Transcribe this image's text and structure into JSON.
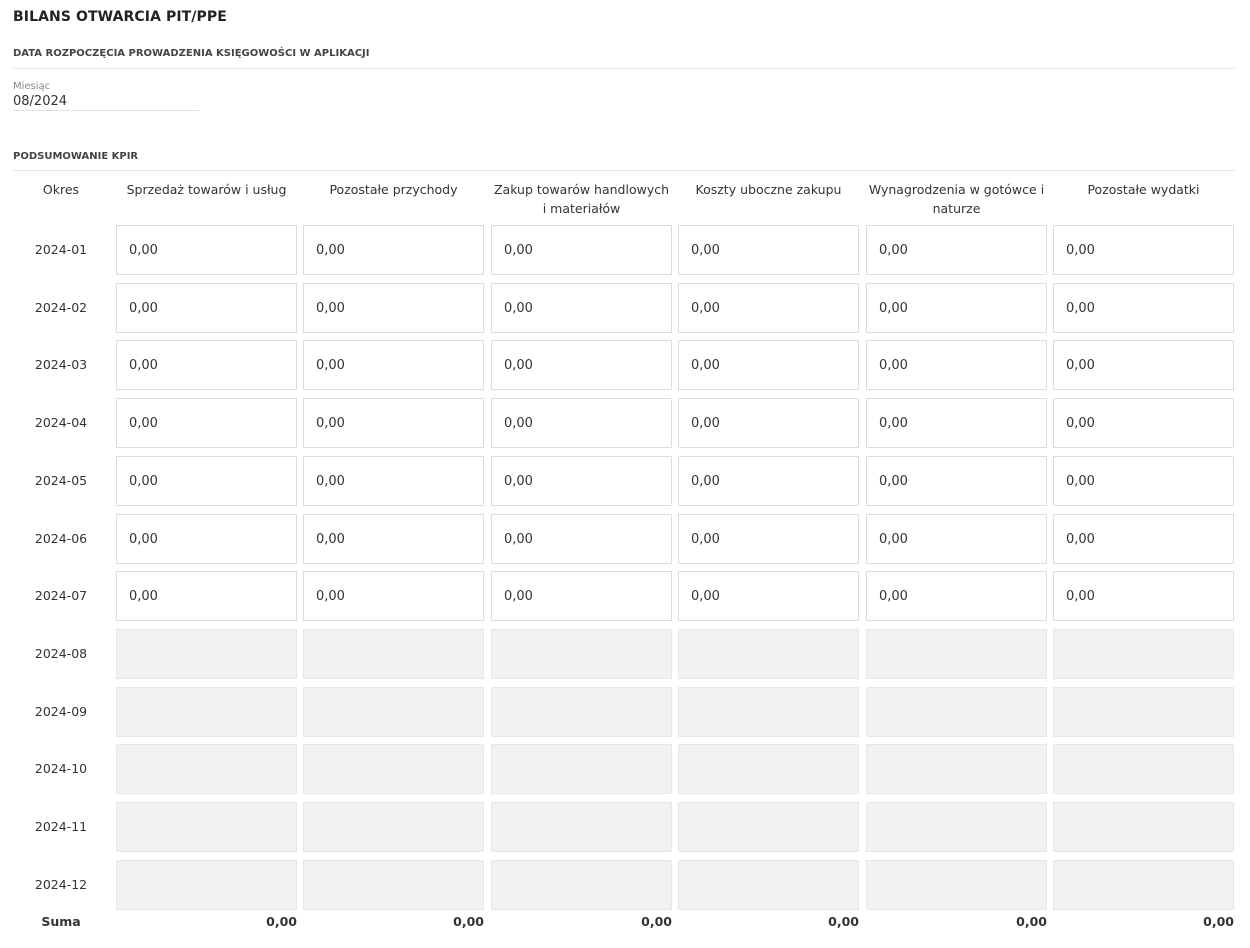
{
  "page_title": "BILANS OTWARCIA PIT/PPE",
  "start_section": {
    "title": "DATA ROZPOCZĘCIA PROWADZENIA KSIĘGOWOŚCI W APLIKACJI",
    "month_label": "Miesiąc",
    "month_value": "08/2024"
  },
  "kpir": {
    "title": "PODSUMOWANIE KPIR",
    "period_header": "Okres",
    "columns": [
      "Sprzedaż towarów i usług",
      "Pozostałe przychody",
      "Zakup towarów handlowych i materiałów",
      "Koszty uboczne zakupu",
      "Wynagrodzenia w gotówce i naturze",
      "Pozostałe wydatki"
    ],
    "rows": [
      {
        "period": "2024-01",
        "enabled": true,
        "values": [
          "0,00",
          "0,00",
          "0,00",
          "0,00",
          "0,00",
          "0,00"
        ]
      },
      {
        "period": "2024-02",
        "enabled": true,
        "values": [
          "0,00",
          "0,00",
          "0,00",
          "0,00",
          "0,00",
          "0,00"
        ]
      },
      {
        "period": "2024-03",
        "enabled": true,
        "values": [
          "0,00",
          "0,00",
          "0,00",
          "0,00",
          "0,00",
          "0,00"
        ]
      },
      {
        "period": "2024-04",
        "enabled": true,
        "values": [
          "0,00",
          "0,00",
          "0,00",
          "0,00",
          "0,00",
          "0,00"
        ]
      },
      {
        "period": "2024-05",
        "enabled": true,
        "values": [
          "0,00",
          "0,00",
          "0,00",
          "0,00",
          "0,00",
          "0,00"
        ]
      },
      {
        "period": "2024-06",
        "enabled": true,
        "values": [
          "0,00",
          "0,00",
          "0,00",
          "0,00",
          "0,00",
          "0,00"
        ]
      },
      {
        "period": "2024-07",
        "enabled": true,
        "values": [
          "0,00",
          "0,00",
          "0,00",
          "0,00",
          "0,00",
          "0,00"
        ]
      },
      {
        "period": "2024-08",
        "enabled": false,
        "values": [
          "",
          "",
          "",
          "",
          "",
          ""
        ]
      },
      {
        "period": "2024-09",
        "enabled": false,
        "values": [
          "",
          "",
          "",
          "",
          "",
          ""
        ]
      },
      {
        "period": "2024-10",
        "enabled": false,
        "values": [
          "",
          "",
          "",
          "",
          "",
          ""
        ]
      },
      {
        "period": "2024-11",
        "enabled": false,
        "values": [
          "",
          "",
          "",
          "",
          "",
          ""
        ]
      },
      {
        "period": "2024-12",
        "enabled": false,
        "values": [
          "",
          "",
          "",
          "",
          "",
          ""
        ]
      }
    ],
    "sum_label": "Suma",
    "sums": [
      "0,00",
      "0,00",
      "0,00",
      "0,00",
      "0,00",
      "0,00"
    ]
  }
}
